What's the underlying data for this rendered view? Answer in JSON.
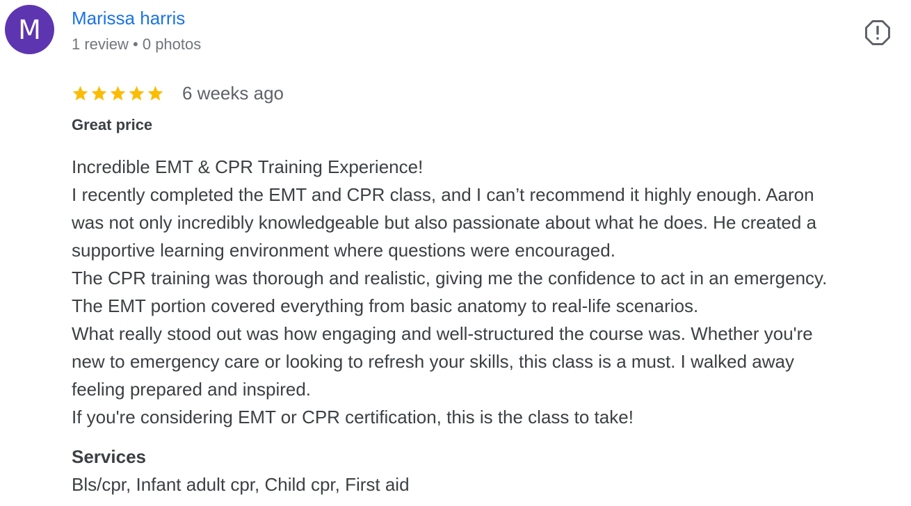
{
  "reviewer": {
    "avatar_letter": "M",
    "avatar_color": "#5e35b1",
    "name": "Marissa harris",
    "meta": "1 review • 0 photos"
  },
  "report": {
    "icon": "report-flag-icon"
  },
  "rating": {
    "stars": 5,
    "max_stars": 5,
    "star_color": "#fbbc04",
    "time": "6 weeks ago"
  },
  "review": {
    "title": "Great price",
    "body_lines": [
      "Incredible EMT & CPR Training Experience!",
      "I recently completed the EMT and CPR class, and I can’t recommend it highly enough. Aaron",
      "was not only incredibly knowledgeable but also passionate about what he does. He created a",
      "supportive learning environment where questions were encouraged.",
      "The CPR training was thorough and realistic, giving me the confidence to act in an emergency.",
      "The EMT portion covered everything from basic anatomy to real-life scenarios.",
      "What really stood out was how engaging and well-structured the course was. Whether you're",
      "new to emergency care or looking to refresh your skills, this class is a must. I walked away",
      "feeling prepared and inspired.",
      "If you're considering EMT or CPR certification, this is the class to take!"
    ]
  },
  "services": {
    "heading": "Services",
    "list": "Bls/cpr, Infant adult cpr, Child cpr, First aid"
  }
}
